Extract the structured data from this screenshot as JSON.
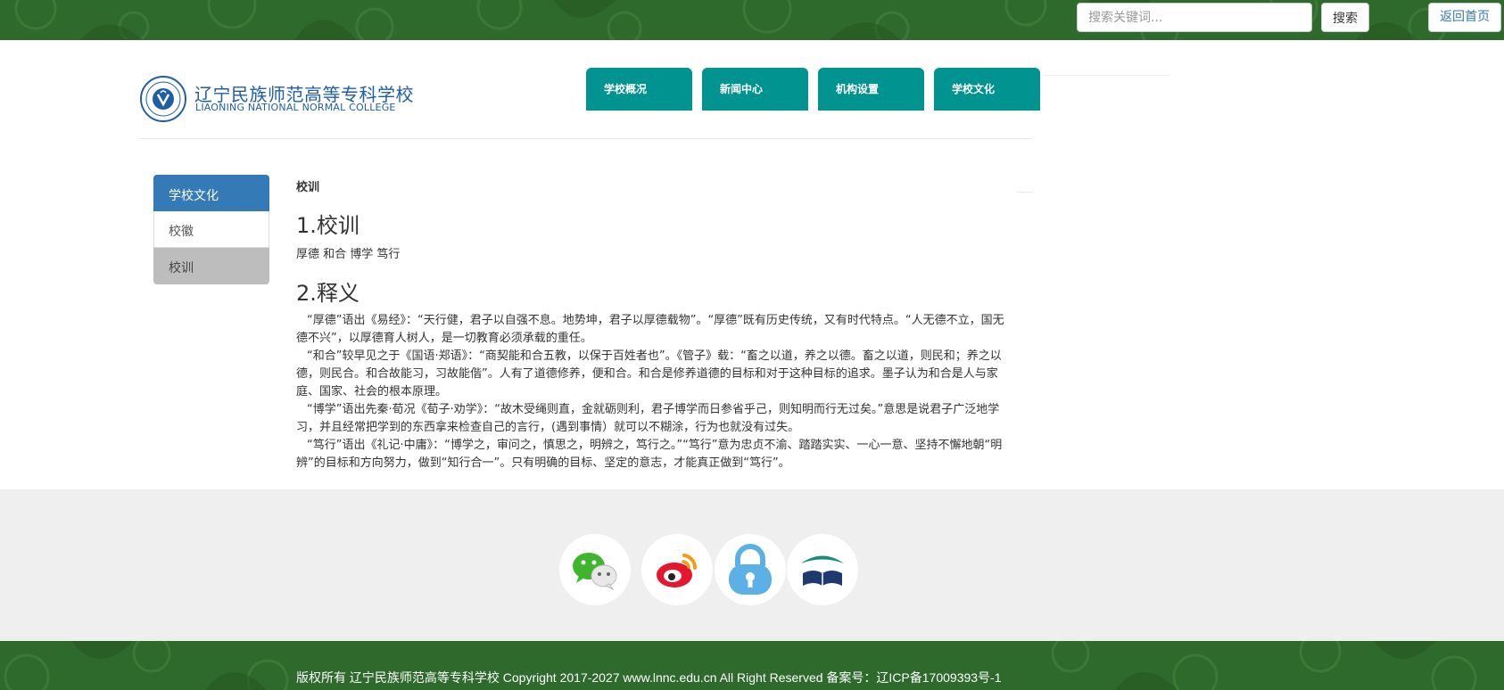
{
  "topbar": {
    "search_placeholder": "搜索关键词...",
    "search_button": "搜索",
    "home_link": "返回首页"
  },
  "header": {
    "school_name": "辽宁民族师范高等专科学校",
    "school_name_en": "LIAONING NATIONAL NORMAL COLLEGE",
    "nav": [
      "学校概况",
      "新闻中心",
      "机构设置",
      "学校文化"
    ]
  },
  "sidebar": {
    "title": "学校文化",
    "items": [
      {
        "label": "校徽",
        "active": false
      },
      {
        "label": "校训",
        "active": true
      }
    ]
  },
  "content": {
    "breadcrumb": "校训",
    "heading1": "1.校训",
    "motto": "厚德 和合 博学 笃行",
    "heading2": "2.释义",
    "paragraphs": [
      "“厚德”语出《易经》：“天行健，君子以自强不息。地势坤，君子以厚德载物”。“厚德”既有历史传统，又有时代特点。“人无德不立，国无德不兴”，以厚德育人树人，是一切教育必须承载的重任。",
      "“和合”较早见之于《国语·郑语》：“商契能和合五教，以保于百姓者也”。《管子》载：“畜之以道，养之以德。畜之以道，则民和；养之以德，则民合。和合故能习，习故能偕”。人有了道德修养，便和合。和合是修养道德的目标和对于这种目标的追求。墨子认为和合是人与家庭、国家、社会的根本原理。",
      "“博学”语出先秦·荀况《荀子·劝学》：“故木受绳则直，金就砺则利，君子博学而日参省乎己，则知明而行无过矣。”意思是说君子广泛地学习，并且经常把学到的东西拿来检查自己的言行，(遇到事情）就可以不糊涂，行为也就没有过失。",
      "“笃行”语出《礼记·中庸》：“博学之，审问之，慎思之，明辨之，笃行之。”“笃行”意为忠贞不渝、踏踏实实、一心一意、坚持不懈地朝“明辨”的目标和方向努力，做到“知行合一”。只有明确的目标、坚定的意志，才能真正做到“笃行”。"
    ]
  },
  "footer": {
    "social": [
      "wechat-icon",
      "weibo-icon",
      "lock-icon",
      "book-logo-icon"
    ],
    "copyright": "版权所有 辽宁民族师范高等专科学校 Copyright 2017-2027 www.lnnc.edu.cn All Right Reserved 备案号：辽ICP备17009393号-1"
  },
  "colors": {
    "green_bar": "#2e6a2c",
    "nav_teal": "#00938f",
    "sidebar_blue": "#337ab7",
    "active_gray": "#bdbdbd",
    "footer_gray": "#efefef"
  }
}
